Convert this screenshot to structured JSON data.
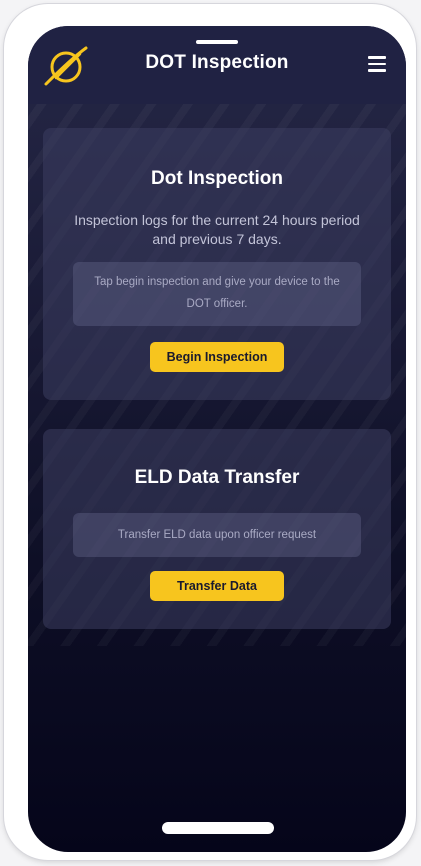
{
  "header": {
    "title": "DOT Inspection",
    "logo_icon": "planet-logo-icon",
    "menu_icon": "hamburger-menu-icon"
  },
  "inspection_card": {
    "title": "Dot Inspection",
    "description": "Inspection logs for the current 24 hours period and previous 7 days.",
    "note": "Tap begin inspection and give your device to the DOT officer.",
    "button_label": "Begin Inspection"
  },
  "transfer_card": {
    "title": "ELD Data Transfer",
    "note": "Transfer ELD data upon officer request",
    "button_label": "Transfer Data"
  },
  "colors": {
    "accent": "#f7c51e",
    "header_bg": "#202243",
    "screen_bg": "#0e0f26"
  }
}
